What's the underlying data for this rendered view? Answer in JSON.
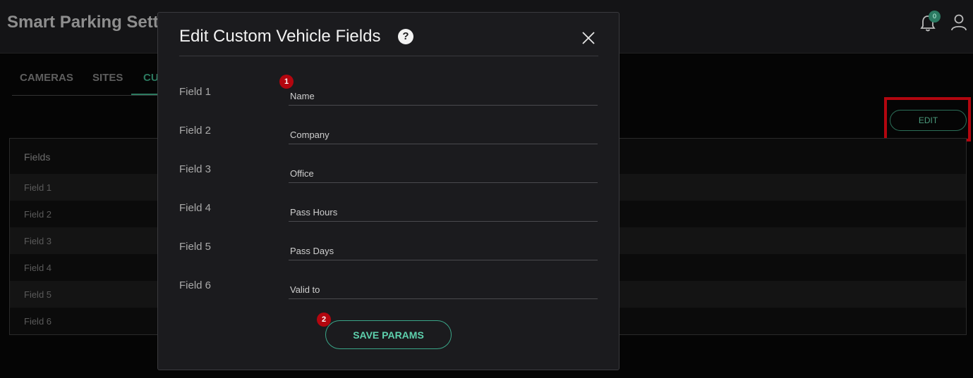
{
  "header": {
    "title": "Smart Parking Sett",
    "notification_count": "0"
  },
  "tabs": [
    {
      "label": "CAMERAS"
    },
    {
      "label": "SITES"
    },
    {
      "label": "CU"
    }
  ],
  "toolbar": {
    "edit_label": "EDIT"
  },
  "table": {
    "header": "Fields",
    "rows": [
      "Field 1",
      "Field 2",
      "Field 3",
      "Field 4",
      "Field 5",
      "Field 6"
    ]
  },
  "modal": {
    "title": "Edit Custom Vehicle Fields",
    "help_glyph": "?",
    "fields": [
      {
        "label": "Field 1",
        "value": "Name"
      },
      {
        "label": "Field 2",
        "value": "Company"
      },
      {
        "label": "Field 3",
        "value": "Office"
      },
      {
        "label": "Field 4",
        "value": "Pass Hours"
      },
      {
        "label": "Field 5",
        "value": "Pass Days"
      },
      {
        "label": "Field 6",
        "value": "Valid to"
      }
    ],
    "save_label": "SAVE PARAMS"
  },
  "steps": {
    "one": "1",
    "two": "2"
  },
  "colors": {
    "accent": "#2c7a60",
    "save_accent": "#5ed1ad",
    "highlight": "#b3060f"
  }
}
